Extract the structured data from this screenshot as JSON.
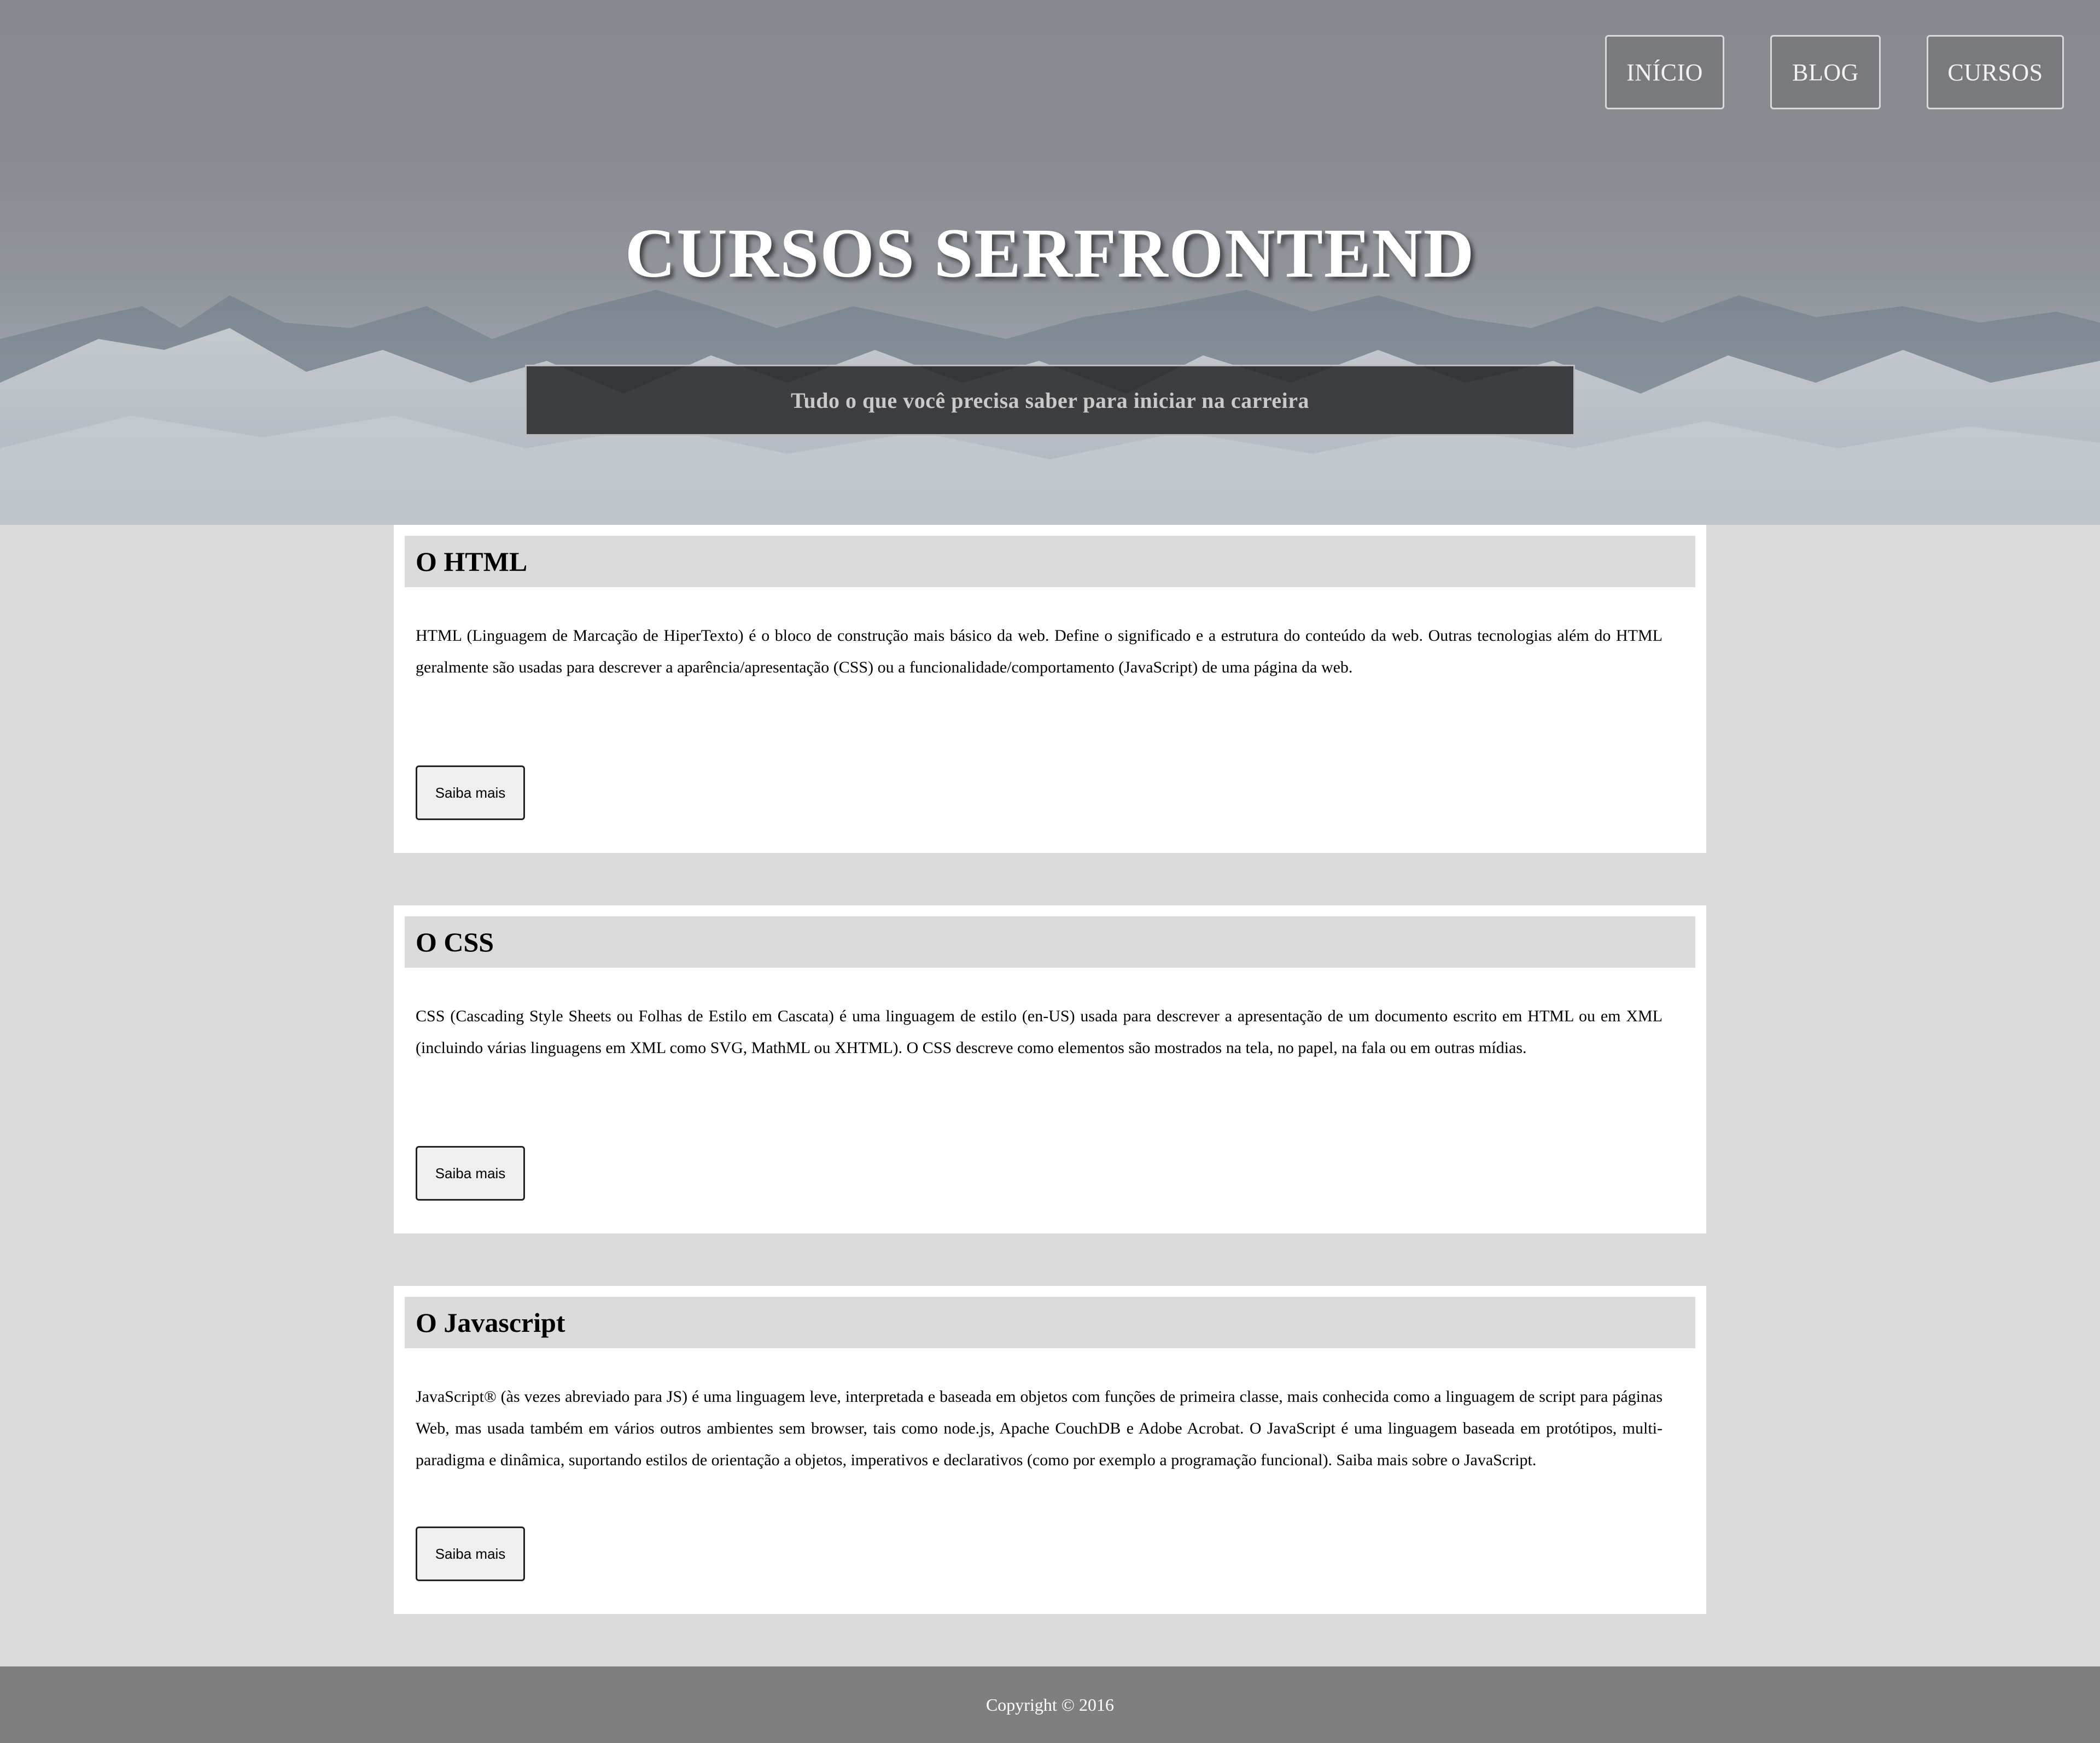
{
  "nav": {
    "items": [
      {
        "label": "INÍCIO"
      },
      {
        "label": "BLOG"
      },
      {
        "label": "CURSOS"
      }
    ]
  },
  "hero": {
    "title": "CURSOS SERFRONTEND",
    "subtitle": "Tudo o que você precisa saber para iniciar na carreira"
  },
  "cards": [
    {
      "title": "O HTML",
      "text": "HTML (Linguagem de Marcação de HiperTexto) é o bloco de construção mais básico da web. Define o significado e a estrutura do conteúdo da web. Outras tecnologias além do HTML geralmente são usadas para descrever a aparência/apresentação (CSS) ou a funcionalidade/comportamento (JavaScript) de uma página da web.",
      "button": "Saiba mais"
    },
    {
      "title": "O CSS",
      "text": "CSS (Cascading Style Sheets ou Folhas de Estilo em Cascata) é uma linguagem de estilo (en-US) usada para descrever a apresentação de um documento escrito em HTML ou em XML (incluindo várias linguagens em XML como SVG, MathML ou XHTML). O CSS descreve como elementos são mostrados na tela, no papel, na fala ou em outras mídias.",
      "button": "Saiba mais"
    },
    {
      "title": "O Javascript",
      "text": "JavaScript® (às vezes abreviado para JS) é uma linguagem leve, interpretada e baseada em objetos com funções de primeira classe, mais conhecida como a linguagem de script para páginas Web, mas usada também em vários outros ambientes sem browser, tais como node.js, Apache CouchDB e Adobe Acrobat. O JavaScript é uma linguagem baseada em protótipos, multi-paradigma e dinâmica, suportando estilos de orientação a objetos, imperativos e declarativos (como por exemplo a programação funcional). Saiba mais sobre o JavaScript.",
      "button": "Saiba mais"
    }
  ],
  "footer": {
    "text": "Copyright © 2016"
  },
  "colors": {
    "page_background": "#dbdbdb",
    "card_background": "#ffffff",
    "card_title_background": "#dbdbdb",
    "footer_background": "#7f7f7f",
    "subtitle_background": "#26282a"
  }
}
